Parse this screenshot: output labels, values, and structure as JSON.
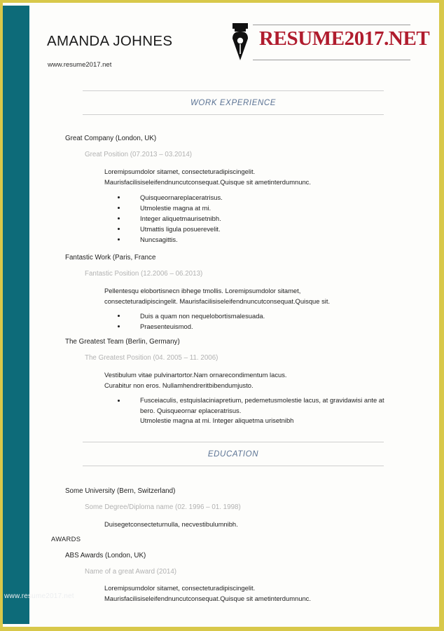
{
  "document": {
    "type": "resume-template",
    "accent_teal": "#0d6b79",
    "frame_yellow": "#d8c84a",
    "section_title_color": "#5b7394",
    "logo_red": "#b01c2e"
  },
  "header": {
    "name": "AMANDA JOHNES",
    "website": "www.resume2017.net",
    "logo": {
      "text": "RESUME2017.NET",
      "icon": "pen-nib-icon"
    }
  },
  "sections": [
    {
      "title": "WORK EXPERIENCE",
      "entries": [
        {
          "organization": "Great Company (London, UK)",
          "role": "Great Position (07.2013 – 03.2014)",
          "body": [
            "Loremipsumdolor sitamet, consecteturadipiscingelit.",
            "Maurisfacilisiseleifendnuncutconsequat.Quisque sit ametinterdumnunc."
          ],
          "bullets": [
            "Quisqueornareplaceratrisus.",
            "Utmolestie magna at mi.",
            "Integer aliquetmaurisetnibh.",
            "Utmattis ligula posuerevelit.",
            "Nuncsagittis."
          ]
        },
        {
          "organization": "Fantastic Work (Paris, France",
          "role": "Fantastic Position (12.2006 – 06.2013)",
          "body": [
            "Pellentesqu elobortisnecn ibhege tmollis. Loremipsumdolor sitamet,",
            "consecteturadipiscingelit. Maurisfacilisiseleifendnuncutconsequat.Quisque sit."
          ],
          "bullets": [
            "Duis a quam non nequelobortismalesuada.",
            "Praesenteuismod."
          ]
        },
        {
          "organization": "The Greatest Team (Berlin, Germany)",
          "role": "The Greatest Position (04. 2005 – 11. 2006)",
          "body": [
            "Vestibulum vitae pulvinartortor.Nam ornarecondimentum lacus.",
            "Curabitur non eros. Nullamhendreritbibendumjusto."
          ],
          "bullets_multiline": [
            [
              "Fusceiaculis, estquislaciniapretium, pedemetusmolestie lacus, at gravidawisi ante at",
              "bero. Quisqueornar eplaceratrisus.",
              "Utmolestie magna at mi. Integer aliquetma urisetnibh"
            ]
          ]
        }
      ]
    },
    {
      "title": "EDUCATION",
      "entries": [
        {
          "organization": "Some University (Bern, Switzerland)",
          "role": "Some Degree/Diploma name (02. 1996 – 01. 1998)",
          "body": [
            "Duisegetconsecteturnulla, necvestibulumnibh."
          ]
        }
      ]
    }
  ],
  "awards": {
    "label": "AWARDS",
    "organization": "ABS Awards (London, UK)",
    "role": "Name of a great Award (2014)",
    "body": [
      "Loremipsumdolor sitamet, consecteturadipiscingelit.",
      "Maurisfacilisiseleifendnuncutconsequat.Quisque sit ametinterdumnunc."
    ]
  },
  "watermark": {
    "text": "www.resume2017.net"
  }
}
